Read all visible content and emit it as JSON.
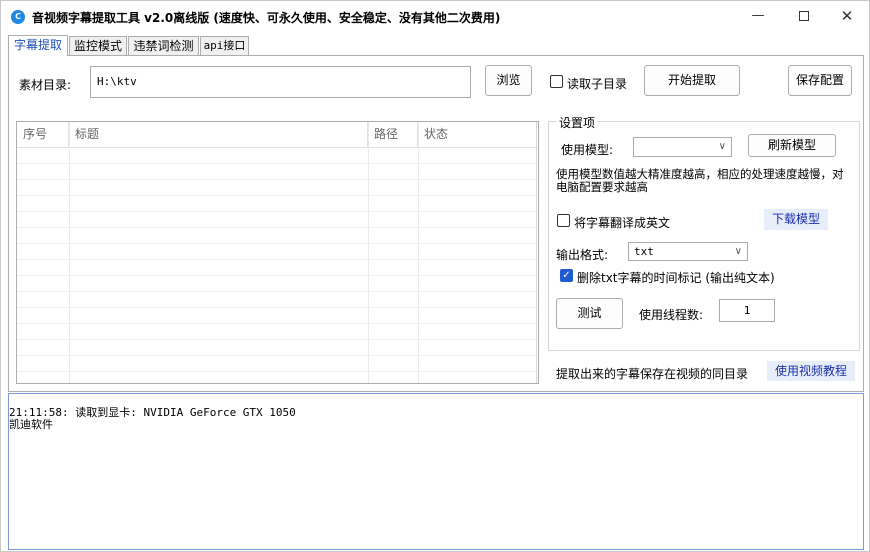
{
  "window": {
    "title": "音视频字幕提取工具 v2.0离线版 (速度快、可永久使用、安全稳定、没有其他二次费用)",
    "minimize_glyph": "—",
    "close_glyph": "✕",
    "icon": "app-logo-icon"
  },
  "tabs": [
    {
      "label": "字幕提取",
      "active": true
    },
    {
      "label": "监控模式",
      "active": false
    },
    {
      "label": "违禁词检测",
      "active": false
    },
    {
      "label": "api接口",
      "active": false
    }
  ],
  "source": {
    "label": "素材目录:",
    "value": "H:\\ktv",
    "browse_label": "浏览",
    "subdir_label": "读取子目录",
    "subdir_checked": false,
    "start_label": "开始提取",
    "save_label": "保存配置"
  },
  "table": {
    "columns": [
      "序号",
      "标题",
      "路径",
      "状态"
    ],
    "rows": []
  },
  "settings": {
    "legend": "设置项",
    "model_label": "使用模型:",
    "model_value": "",
    "refresh_label": "刷新模型",
    "model_hint": "使用模型数值越大精准度越高，相应的处理速度越慢，对电脑配置要求越高",
    "translate_label": "将字幕翻译成英文",
    "translate_checked": false,
    "download_label": "下载模型",
    "format_label": "输出格式:",
    "format_value": "txt",
    "strip_time_label": "删除txt字幕的时间标记 (输出纯文本)",
    "strip_time_checked": true,
    "test_label": "测试",
    "threads_label": "使用线程数:",
    "threads_value": "1"
  },
  "footer": {
    "save_hint": "提取出来的字幕保存在视频的同目录",
    "tutorial_label": "使用视频教程"
  },
  "log": {
    "lines": [
      "21:11:58: 读取到显卡: NVIDIA GeForce GTX 1050",
      "凯迪软件"
    ]
  },
  "colors": {
    "accent": "#1e5bd0",
    "link_bg": "#e7eef9",
    "link_text": "#1a2fb0",
    "log_border": "#7a9bd6"
  }
}
